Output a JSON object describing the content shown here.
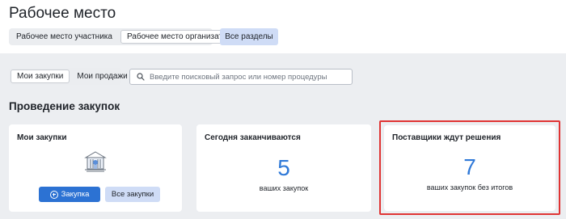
{
  "header": {
    "title": "Рабочее место",
    "role_tabs": [
      {
        "label": "Рабочее место участника",
        "active": false
      },
      {
        "label": "Рабочее место организатора",
        "active": true
      }
    ],
    "all_sections_label": "Все разделы"
  },
  "toolbar": {
    "tabs": [
      {
        "label": "Мои закупки",
        "active": true
      },
      {
        "label": "Мои продажи",
        "active": false
      }
    ],
    "search_placeholder": "Введите поисковый запрос или номер процедуры",
    "search_icon": "search-icon"
  },
  "section": {
    "title": "Проведение закупок"
  },
  "cards": {
    "my_purchases": {
      "title": "Мои закупки",
      "icon": "building-icon",
      "create_label": "Закупка",
      "all_label": "Все закупки"
    },
    "ending_today": {
      "title": "Сегодня заканчиваются",
      "count": "5",
      "caption": "ваших закупок"
    },
    "awaiting_decision": {
      "title": "Поставщики ждут решения",
      "count": "7",
      "caption": "ваших закупок без итогов"
    }
  },
  "colors": {
    "accent": "#2c72d3",
    "number": "#2f79d8",
    "highlight": "#e03434",
    "secondary_button": "#cfdcf6",
    "background": "#eceef1"
  }
}
